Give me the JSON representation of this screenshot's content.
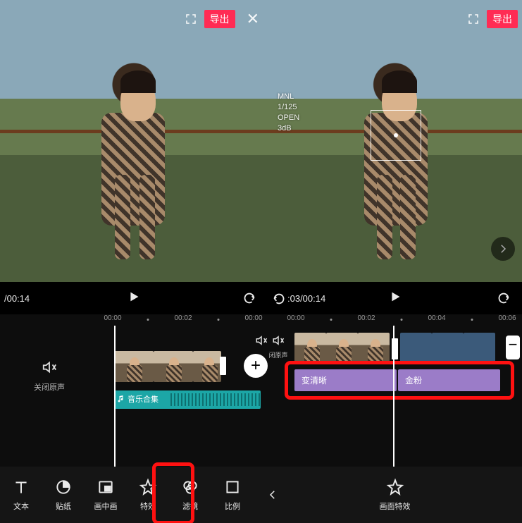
{
  "left": {
    "topbar": {
      "export": "导出"
    },
    "controls": {
      "time": "/00:14"
    },
    "ruler": [
      "00:00",
      "00:02",
      "00:00"
    ],
    "mute": {
      "labelName": "volume-off-icon",
      "text": "关闭原声"
    },
    "audio": {
      "label": "音乐合集"
    },
    "tools": [
      {
        "name": "text-tool",
        "label": "文本",
        "icon": "T"
      },
      {
        "name": "sticker-tool",
        "label": "贴纸",
        "icon": "pie"
      },
      {
        "name": "pip-tool",
        "label": "画中画",
        "icon": "rect"
      },
      {
        "name": "effects-tool",
        "label": "特效",
        "icon": "star"
      },
      {
        "name": "filter-tool",
        "label": "滤镜",
        "icon": "tri"
      },
      {
        "name": "ratio-tool",
        "label": "比例",
        "icon": "sq"
      }
    ]
  },
  "right": {
    "topbar": {
      "export": "导出"
    },
    "meta": {
      "line1": "MNL",
      "line2": "1/125",
      "line3": "OPEN",
      "line4": "3dB"
    },
    "controls": {
      "time": ":03/00:14"
    },
    "ruler": [
      "00:00",
      "00:02",
      "00:04",
      "00:06"
    ],
    "mute_compact": {
      "text": "闭原声"
    },
    "effects": [
      {
        "name": "effect-clarity",
        "label": "变清晰"
      },
      {
        "name": "effect-gold-dust",
        "label": "金粉"
      }
    ],
    "tool_single": {
      "name": "canvas-effects-tool",
      "label": "画面特效"
    }
  }
}
